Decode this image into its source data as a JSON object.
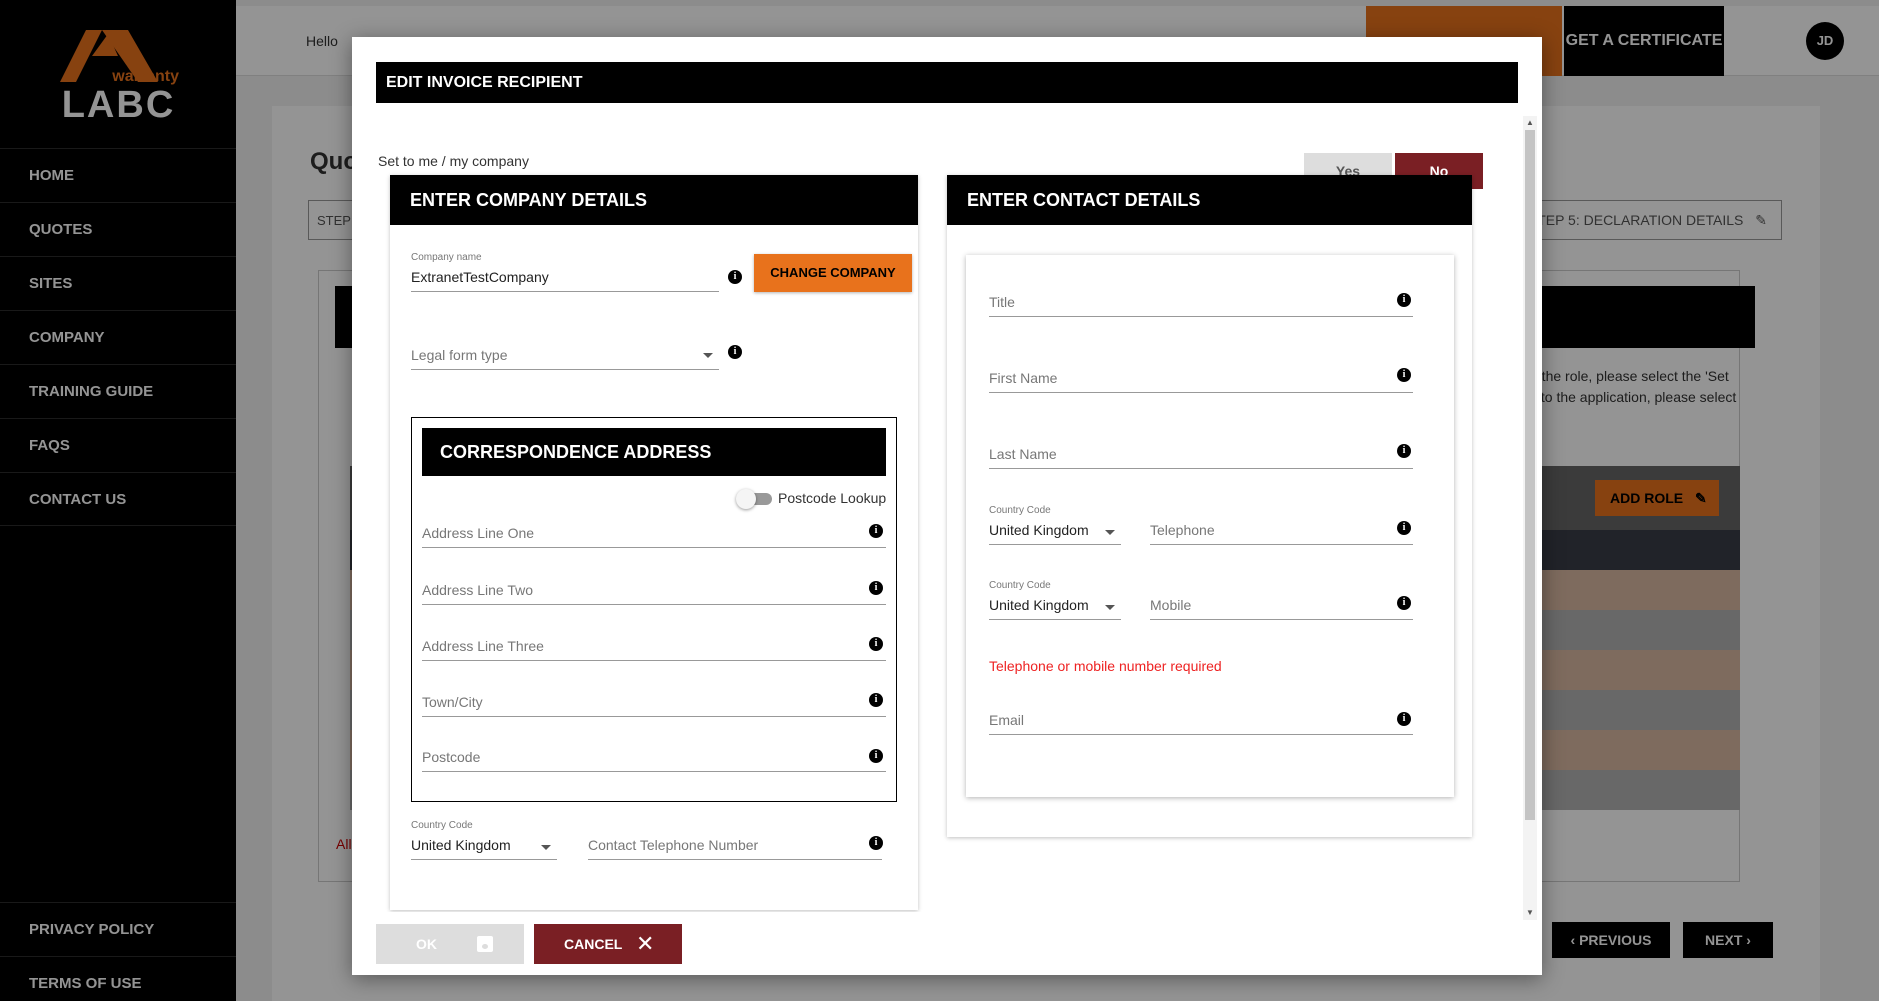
{
  "sidebar": {
    "logo_sub": "warranty",
    "logo_word": "LABC",
    "items": [
      {
        "label": "HOME"
      },
      {
        "label": "QUOTES"
      },
      {
        "label": "SITES"
      },
      {
        "label": "COMPANY"
      },
      {
        "label": "TRAINING GUIDE"
      },
      {
        "label": "FAQS"
      },
      {
        "label": "CONTACT US"
      }
    ],
    "bottom_items": [
      {
        "label": "PRIVACY POLICY"
      },
      {
        "label": "TERMS OF USE"
      }
    ]
  },
  "header": {
    "hello": "Hello",
    "get_certificate": "GET A CERTIFICATE",
    "avatar": "JD"
  },
  "background": {
    "title": "Quo",
    "step_left": "STEP",
    "step_right": "STEP 5: DECLARATION DETAILS",
    "desc_line1": "n the role, please select the 'Set",
    "desc_line2": "s to the application, please select",
    "add_role": "ADD ROLE",
    "all_text": "All",
    "previous": "PREVIOUS",
    "next": "NEXT"
  },
  "modal": {
    "title": "EDIT INVOICE RECIPIENT",
    "set_to_label": "Set to me / my company",
    "yes": "Yes",
    "no": "No",
    "company": {
      "heading": "ENTER COMPANY DETAILS",
      "company_name_label": "Company name",
      "company_name_value": "ExtranetTestCompany",
      "change_company": "CHANGE COMPANY",
      "legal_form_placeholder": "Legal form type",
      "correspondence": {
        "heading": "CORRESPONDENCE ADDRESS",
        "postcode_lookup": "Postcode Lookup",
        "address_line_one": "Address Line One",
        "address_line_two": "Address Line Two",
        "address_line_three": "Address Line Three",
        "town_city": "Town/City",
        "postcode": "Postcode"
      },
      "country_code_label": "Country Code",
      "country_value": "United Kingdom",
      "contact_telephone": "Contact Telephone Number"
    },
    "contact": {
      "heading": "ENTER CONTACT DETAILS",
      "title": "Title",
      "first_name": "First Name",
      "last_name": "Last Name",
      "country_code_label": "Country Code",
      "country_value": "United Kingdom",
      "telephone": "Telephone",
      "mobile": "Mobile",
      "error": "Telephone or mobile number required",
      "email": "Email"
    },
    "ok": "OK",
    "cancel": "CANCEL"
  }
}
